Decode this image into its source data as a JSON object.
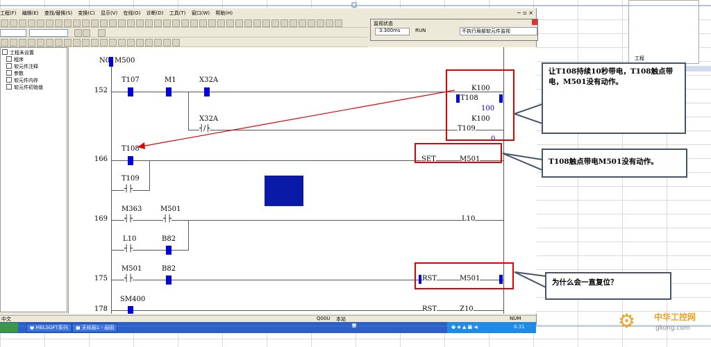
{
  "menu": [
    "工程(F)",
    "编辑(E)",
    "查找/替换(S)",
    "变换(C)",
    "显示(V)",
    "在线(O)",
    "诊断(D)",
    "工具(T)",
    "窗口(W)",
    "帮助(H)"
  ],
  "tree": {
    "items": [
      "工程未设置",
      "程序",
      "软元件注释",
      "参数",
      "软元件内存",
      "软元件初始值"
    ]
  },
  "monitor": {
    "title": "监视状态",
    "scan_time": "3.300ms",
    "mode": "RUN",
    "option": "不执行局部软元件监视"
  },
  "ladder": {
    "rung0": {
      "label": "N0",
      "contact": "M500"
    },
    "rung152": {
      "step": "152",
      "contacts": [
        "T107",
        "M1",
        "X32A"
      ],
      "branch_contact": "X32A",
      "coil1": {
        "name": "T108",
        "k": "K100",
        "value": "100"
      },
      "coil2": {
        "name": "T109",
        "k": "K100",
        "value": "0"
      }
    },
    "rung166": {
      "step": "166",
      "contact": "T108",
      "branch_contact": "T109",
      "instruction": "SET",
      "operand": "M501"
    },
    "rung169": {
      "step": "169",
      "contacts": [
        "M363",
        "M501"
      ],
      "branch_contacts": [
        "L10",
        "B82"
      ],
      "coil": "L10"
    },
    "rung175": {
      "step": "175",
      "contacts": [
        "M501",
        "B82"
      ],
      "instruction": "RST",
      "operand": "M501"
    },
    "rung178": {
      "step": "178",
      "contact": "SM400",
      "instruction": "RST",
      "operand": "Z10"
    }
  },
  "status": {
    "left": "中文",
    "plc": "Q00U",
    "station": "本站",
    "num": "NUM"
  },
  "taskbar": {
    "tasks": [
      "MELSOFT系列",
      "无标题1 - 画图"
    ],
    "clock": "8:31"
  },
  "callouts": {
    "c1": "让T108持续10秒带电，T108触点带电，M501没有动作。",
    "c2": "T108触点带电M501没有动作。",
    "c3": "为什么会一直复位？"
  },
  "watermark": {
    "name": "中华工控网",
    "url": "gkong.com"
  },
  "excel_panel": {
    "tab": "工程"
  },
  "colors": {
    "accent_blue": "#0000dd",
    "highlight_red": "#e00000",
    "callout_border": "#44546a"
  }
}
